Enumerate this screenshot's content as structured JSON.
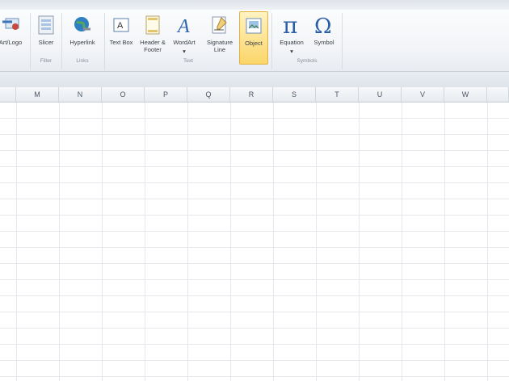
{
  "ribbon": {
    "buttons": [
      {
        "key": "clip",
        "label": "Art/Logo"
      },
      {
        "key": "slicer",
        "label": "Slicer"
      },
      {
        "key": "hyperlink",
        "label": "Hyperlink"
      },
      {
        "key": "textbox",
        "label": "Text Box"
      },
      {
        "key": "header",
        "label": "Header & Footer"
      },
      {
        "key": "wordart",
        "label": "WordArt"
      },
      {
        "key": "signature",
        "label": "Signature Line"
      },
      {
        "key": "object",
        "label": "Object"
      },
      {
        "key": "equation",
        "label": "Equation"
      },
      {
        "key": "symbol",
        "label": "Symbol"
      }
    ],
    "groups": {
      "filter": "Filter",
      "links": "Links",
      "text": "Text",
      "symbols": "Symbols"
    }
  },
  "columns": [
    "M",
    "N",
    "O",
    "P",
    "Q",
    "R",
    "S",
    "T",
    "U",
    "V",
    "W"
  ],
  "colors": {
    "selected_fill": "#fbd56a",
    "grid_line": "#e4e7ec",
    "header_bg": "#e7ebf0"
  }
}
